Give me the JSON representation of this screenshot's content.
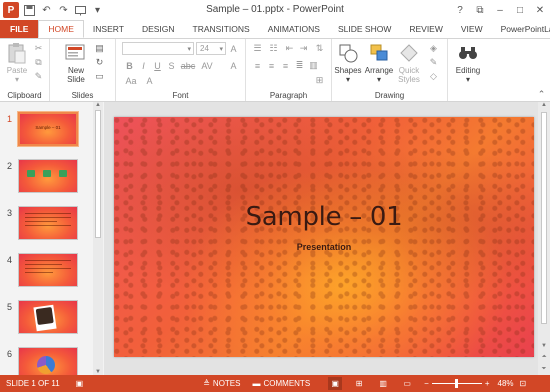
{
  "window": {
    "title": "Sample – 01.pptx - PowerPoint",
    "app_logo": "P",
    "quick_access": [
      "save-icon",
      "undo-icon",
      "redo-icon",
      "start-from-beginning-icon",
      "customize-icon"
    ],
    "controls": [
      "?",
      "⧉",
      "–",
      "□",
      "✕"
    ]
  },
  "tabs": {
    "file": "FILE",
    "items": [
      "HOME",
      "INSERT",
      "DESIGN",
      "TRANSITIONS",
      "ANIMATIONS",
      "SLIDE SHOW",
      "REVIEW",
      "VIEW",
      "PowerPointLabs"
    ],
    "active": "HOME"
  },
  "ribbon": {
    "clipboard": {
      "label": "Clipboard",
      "paste": "Paste"
    },
    "slides": {
      "label": "Slides",
      "new_slide_line1": "New",
      "new_slide_line2": "Slide"
    },
    "font": {
      "label": "Font",
      "font_size": "24",
      "buttons": [
        "B",
        "I",
        "U",
        "S",
        "abc",
        "AV",
        "Aa",
        "A",
        "A",
        "A"
      ]
    },
    "paragraph": {
      "label": "Paragraph"
    },
    "drawing": {
      "label": "Drawing",
      "shapes": "Shapes",
      "arrange": "Arrange",
      "quick_styles_line1": "Quick",
      "quick_styles_line2": "Styles"
    },
    "editing": {
      "label": "Editing"
    }
  },
  "thumbnails": [
    {
      "number": "1",
      "title": "Sample – 01",
      "kind": "title",
      "active": true
    },
    {
      "number": "2",
      "kind": "shapes"
    },
    {
      "number": "3",
      "kind": "text"
    },
    {
      "number": "4",
      "kind": "text"
    },
    {
      "number": "5",
      "kind": "photo"
    },
    {
      "number": "6",
      "kind": "chart"
    }
  ],
  "slide": {
    "title": "Sample – 01",
    "subtitle": "Presentation",
    "background_colors": [
      "#f0525e",
      "#f47a30",
      "#e9414e"
    ]
  },
  "status": {
    "slide_info": "SLIDE 1 OF 11",
    "notes": "NOTES",
    "comments": "COMMENTS",
    "zoom_minus": "−",
    "zoom_plus": "+",
    "zoom_level": "48%",
    "zoom_fraction": 0.48
  },
  "colors": {
    "accent": "#d24726"
  }
}
